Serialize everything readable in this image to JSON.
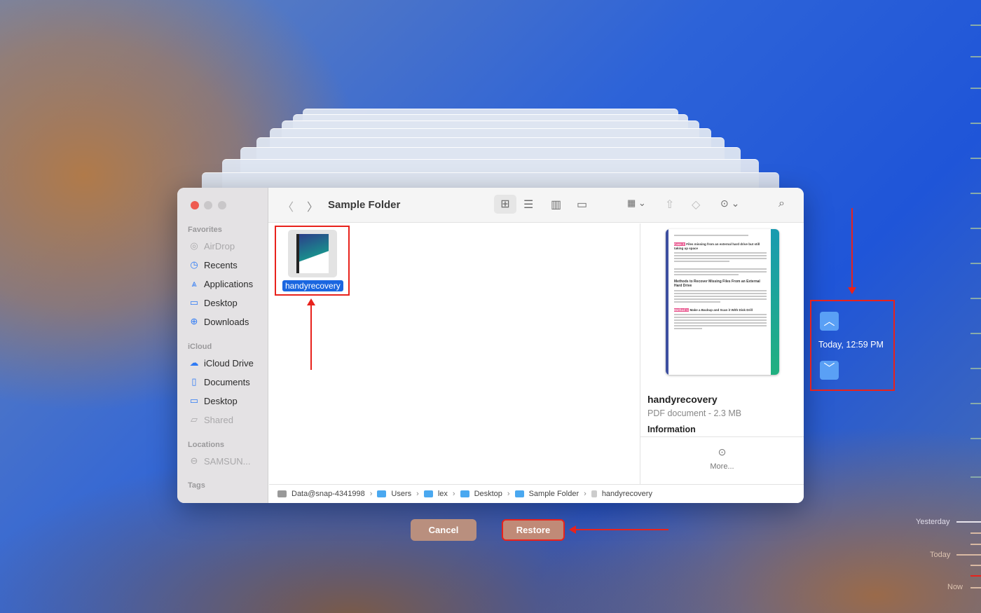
{
  "window": {
    "title": "Sample Folder"
  },
  "sidebar": {
    "favorites_label": "Favorites",
    "favorites": [
      {
        "label": "AirDrop",
        "icon": "airdrop-icon"
      },
      {
        "label": "Recents",
        "icon": "clock-icon"
      },
      {
        "label": "Applications",
        "icon": "applications-icon"
      },
      {
        "label": "Desktop",
        "icon": "desktop-icon"
      },
      {
        "label": "Downloads",
        "icon": "download-icon"
      }
    ],
    "icloud_label": "iCloud",
    "icloud": [
      {
        "label": "iCloud Drive",
        "icon": "cloud-icon"
      },
      {
        "label": "Documents",
        "icon": "document-icon"
      },
      {
        "label": "Desktop",
        "icon": "desktop-icon"
      },
      {
        "label": "Shared",
        "icon": "shared-folder-icon"
      }
    ],
    "locations_label": "Locations",
    "locations": [
      {
        "label": "SAMSUN...",
        "icon": "drive-icon"
      }
    ],
    "tags_label": "Tags"
  },
  "files": [
    {
      "name": "handyrecovery",
      "selected": true
    }
  ],
  "preview": {
    "name": "handyrecovery",
    "kind": "PDF document - 2.3 MB",
    "info_label": "Information",
    "more_label": "More...",
    "doc": {
      "badge1": "Case 2:",
      "h1": "Files missing from an external hard drive but still taking up space",
      "h2": "Methods to Recover Missing Files From an External Hard Drive",
      "badge2": "Method 1:",
      "h3": "Make a Backup and Scan it With Disk Drill"
    }
  },
  "pathbar": [
    "Data@snap-4341998",
    "Users",
    "lex",
    "Desktop",
    "Sample Folder",
    "handyrecovery"
  ],
  "buttons": {
    "cancel": "Cancel",
    "restore": "Restore"
  },
  "timemachine": {
    "current": "Today, 12:59 PM",
    "timeline": [
      "Yesterday",
      "Today",
      "Now"
    ]
  },
  "colors": {
    "accent": "#2f7bf5",
    "annotation": "#e8221c",
    "selection": "#1a66e0"
  }
}
